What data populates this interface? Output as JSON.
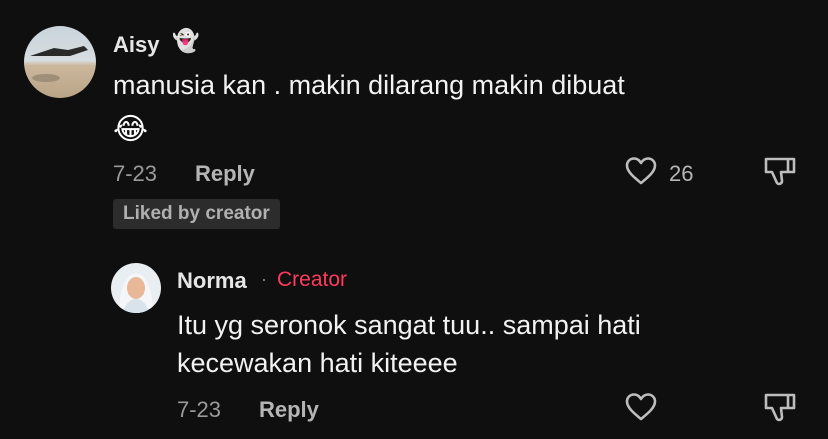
{
  "comment1": {
    "author": "Aisy",
    "author_emoji": "👻",
    "text": "manusia kan . makin dilarang makin dibuat",
    "emoji_line": "😂",
    "date": "7-23",
    "reply_label": "Reply",
    "like_count": "26",
    "liked_badge": "Liked by creator"
  },
  "reply1": {
    "author": "Norma",
    "separator": "·",
    "author_role": "Creator",
    "text_line1": "Itu yg seronok sangat tuu.. sampai hati",
    "text_line2": "kecewakan hati kiteeee",
    "date": "7-23",
    "reply_label": "Reply"
  },
  "icons": {
    "like": "heart-outline-icon",
    "dislike": "thumbs-down-icon"
  },
  "colors": {
    "background": "#0f0f0f",
    "creator_accent": "#ff3b5c",
    "muted_text": "#9a9a9a"
  }
}
